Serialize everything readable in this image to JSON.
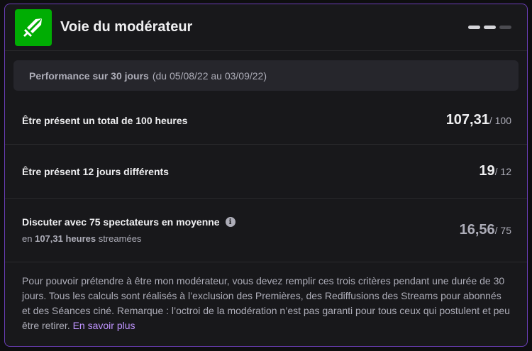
{
  "header": {
    "title": "Voie du modérateur",
    "logo_icon": "sword-icon",
    "accent_color": "#00ad03",
    "progress_steps": 3,
    "progress_active": 2
  },
  "period": {
    "label": "Performance sur 30 jours",
    "range": "(du 05/08/22 au 03/09/22)"
  },
  "criteria": [
    {
      "label": "Être présent un total de 100 heures",
      "value": "107,31",
      "total": "/ 100"
    },
    {
      "label": "Être présent 12 jours différents",
      "value": "19",
      "total": "/ 12"
    },
    {
      "label": "Discuter avec 75 spectateurs en moyenne",
      "value": "16,56",
      "total": "/ 75",
      "sub_prefix": "en",
      "sub_bold": "107,31 heures",
      "sub_suffix": "streamées"
    }
  ],
  "footer": {
    "text": "Pour pouvoir prétendre à être mon modérateur, vous devez remplir ces trois critères pendant une durée de 30 jours. Tous les calculs sont réalisés à l’exclusion des Premières, des Rediffusions des Streams pour abonnés et des Séances ciné. Remarque : l’octroi de la modération n’est pas garanti pour tous ceux qui postulent et peu être retirer.",
    "link": "En savoir plus"
  }
}
